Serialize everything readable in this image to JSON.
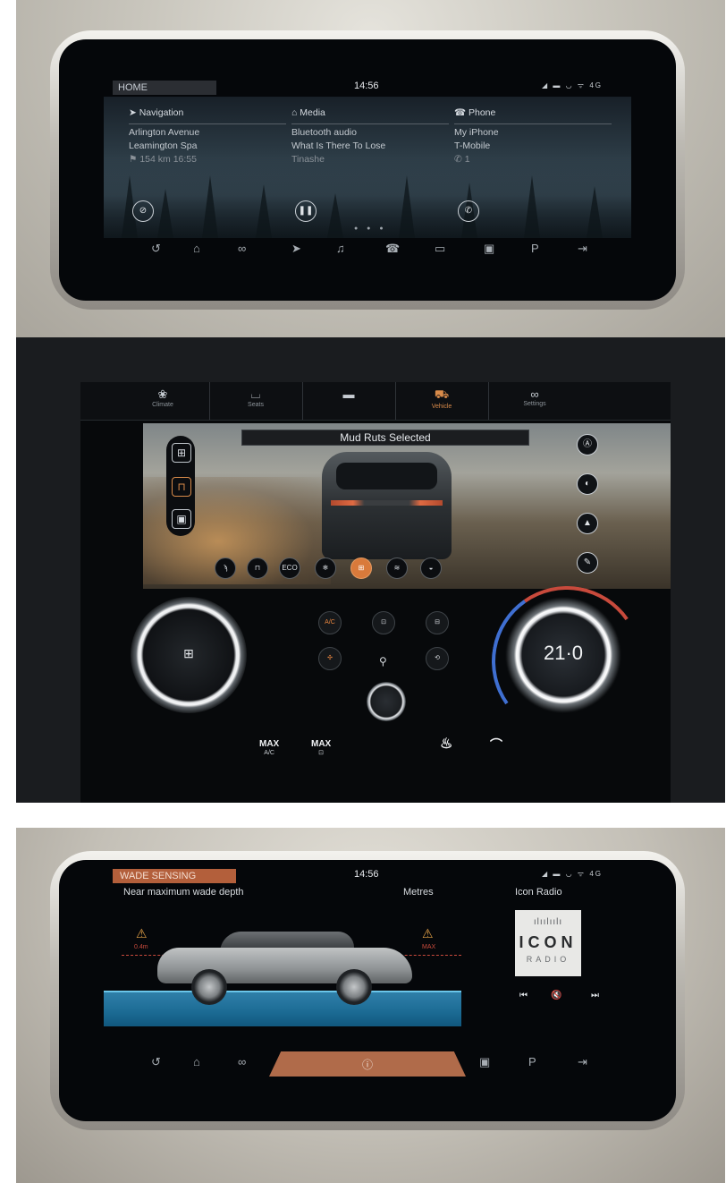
{
  "top_screen": {
    "home_label": "HOME",
    "clock": "14:56",
    "status_icons": "◢ ▬ ◡ ᯤ 4G",
    "navigation": {
      "title": "Navigation",
      "icon": "navigation-arrow-icon",
      "line1": "Arlington Avenue",
      "line2": "Leamington Spa",
      "line3": "154 km 16:55",
      "button_icon": "mute-guidance-icon"
    },
    "media": {
      "title": "Media",
      "icon": "media-icon",
      "line1": "Bluetooth audio",
      "line2": "What Is There To Lose",
      "line3": "Tinashe",
      "button_icon": "pause-icon"
    },
    "phone": {
      "title": "Phone",
      "icon": "phone-icon",
      "line1": "My iPhone",
      "line2": "T-Mobile",
      "line3": "1",
      "button_icon": "call-icon"
    },
    "page_dots": "● ● ●",
    "nav_icons": [
      "back-icon",
      "home-icon",
      "apps-icon",
      "navigation-icon",
      "media-icon",
      "phone-icon",
      "devices-icon",
      "camera-icon",
      "parking-icon",
      "exit-icon"
    ]
  },
  "middle_screen": {
    "tabs": [
      {
        "label": "Climate",
        "icon": "climate-icon"
      },
      {
        "label": "Seats",
        "icon": "seats-icon"
      },
      {
        "label": "",
        "icon": "handle-icon"
      },
      {
        "label": "Vehicle",
        "icon": "vehicle-icon"
      },
      {
        "label": "Settings",
        "icon": "settings-icon"
      }
    ],
    "active_tab": "Vehicle",
    "mode_banner": "Mud Ruts Selected",
    "left_knob_icon": "mud-ruts-icon",
    "temperature": "21·0",
    "bottom_controls": [
      {
        "main": "MAX",
        "sub": "A/C"
      },
      {
        "main": "MAX",
        "sub": "defrost"
      },
      {
        "main": "",
        "sub": "seat heat"
      },
      {
        "main": "",
        "sub": "wipers"
      }
    ],
    "climate_buttons": [
      "A/C",
      "front-defrost",
      "rear-defrost",
      "fan",
      "air-flow",
      "recirculation"
    ],
    "accent_color": "#d97a3b"
  },
  "bottom_screen": {
    "wade_label": "WADE SENSING",
    "clock": "14:56",
    "status_icons": "◢ ▬ ◡ ᯤ 4G",
    "message": "Near maximum wade depth",
    "units": "Metres",
    "radio_name": "Icon Radio",
    "radio_logo_line1": "ICON",
    "radio_logo_line2": "RADIO",
    "max_label": "MAX",
    "min_label": "0.4m",
    "media_controls": [
      "prev-icon",
      "mute-icon",
      "next-icon"
    ],
    "accent_color": "#b35f3b"
  }
}
